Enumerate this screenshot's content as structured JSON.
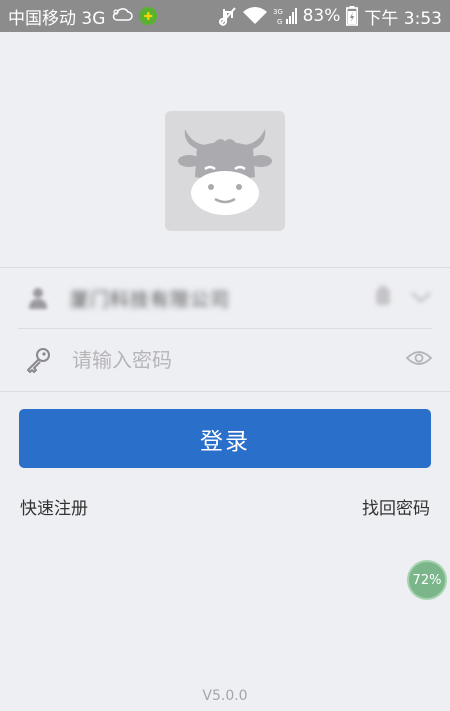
{
  "status_bar": {
    "carrier": "中国移动 3G",
    "battery": "83%",
    "time": "下午 3:53",
    "network_label_top": "3G",
    "network_label_bottom": "G",
    "icons": [
      "weather-icon",
      "app-notification-icon",
      "mute-icon",
      "wifi-icon",
      "signal-icon",
      "battery-icon"
    ]
  },
  "login": {
    "username_value": "厦门科技有限公司",
    "password_placeholder": "请输入密码",
    "login_button": "登录",
    "register_link": "快速注册",
    "forgot_link": "找回密码"
  },
  "progress_badge": {
    "value": "72%",
    "percent": 72
  },
  "footer": {
    "version": "V5.0.0"
  },
  "colors": {
    "primary": "#2a6fc9",
    "background": "#eeeff3",
    "status_bar": "#8c8c8c"
  }
}
